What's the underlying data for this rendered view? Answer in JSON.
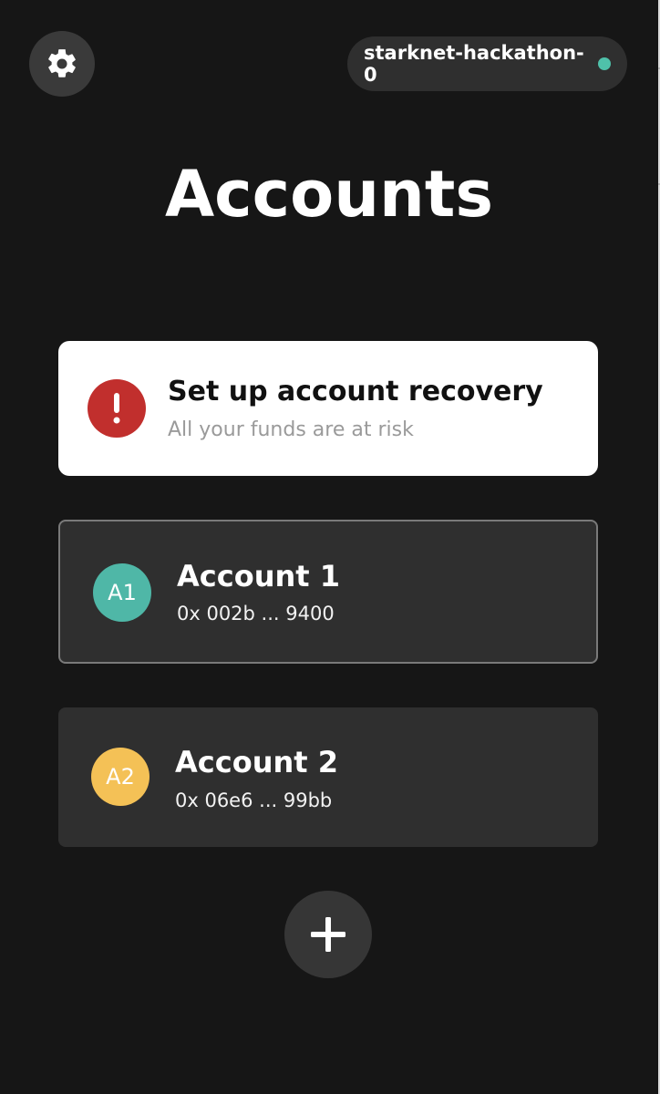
{
  "header": {
    "settings_icon": "gear-icon",
    "network": {
      "label": "starknet-hackathon-0",
      "status_color": "#4fc1aa"
    }
  },
  "page": {
    "title": "Accounts"
  },
  "recovery_banner": {
    "icon": "warning-icon",
    "accent_color": "#c12f2d",
    "title": "Set up account recovery",
    "subtitle": "All your funds are at risk"
  },
  "accounts": [
    {
      "initials": "A1",
      "name": "Account 1",
      "address": "0x 002b ... 9400",
      "avatar_color": "#4fb7a7",
      "selected": true
    },
    {
      "initials": "A2",
      "name": "Account 2",
      "address": "0x 06e6 ... 99bb",
      "avatar_color": "#f4c156",
      "selected": false
    }
  ],
  "actions": {
    "add_icon": "plus-icon"
  }
}
